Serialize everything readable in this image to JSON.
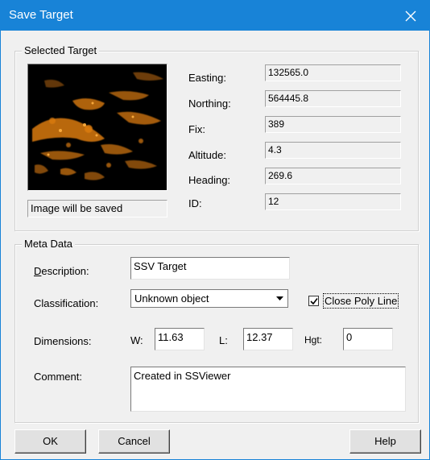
{
  "window": {
    "title": "Save Target"
  },
  "selected_target": {
    "legend": "Selected Target",
    "image_status": "Image will be saved",
    "fields": [
      {
        "label": "Easting:",
        "value": "132565.0"
      },
      {
        "label": "Northing:",
        "value": "564445.8"
      },
      {
        "label": "Fix:",
        "value": "389"
      },
      {
        "label": "Altitude:",
        "value": "4.3"
      },
      {
        "label": "Heading:",
        "value": "269.6"
      },
      {
        "label": "ID:",
        "value": "12"
      }
    ]
  },
  "meta_data": {
    "legend": "Meta Data",
    "description_label_first": "D",
    "description_label_rest": "escription:",
    "description_value": "SSV Target",
    "classification_label": "Classification:",
    "classification_value": "Unknown object",
    "close_poly_line_label": "Close Poly Line",
    "close_poly_line_checked": true,
    "dimensions_label": "Dimensions:",
    "w_label": "W:",
    "w_value": "11.63",
    "l_label": "L:",
    "l_value": "12.37",
    "hgt_label": "Hgt:",
    "hgt_value": "0",
    "comment_label": "Comment:",
    "comment_value": "Created in SSViewer"
  },
  "buttons": {
    "ok": "OK",
    "cancel": "Cancel",
    "help": "Help"
  },
  "icons": {
    "close": "close-icon",
    "dropdown": "chevron-down-icon",
    "check": "check-icon"
  }
}
